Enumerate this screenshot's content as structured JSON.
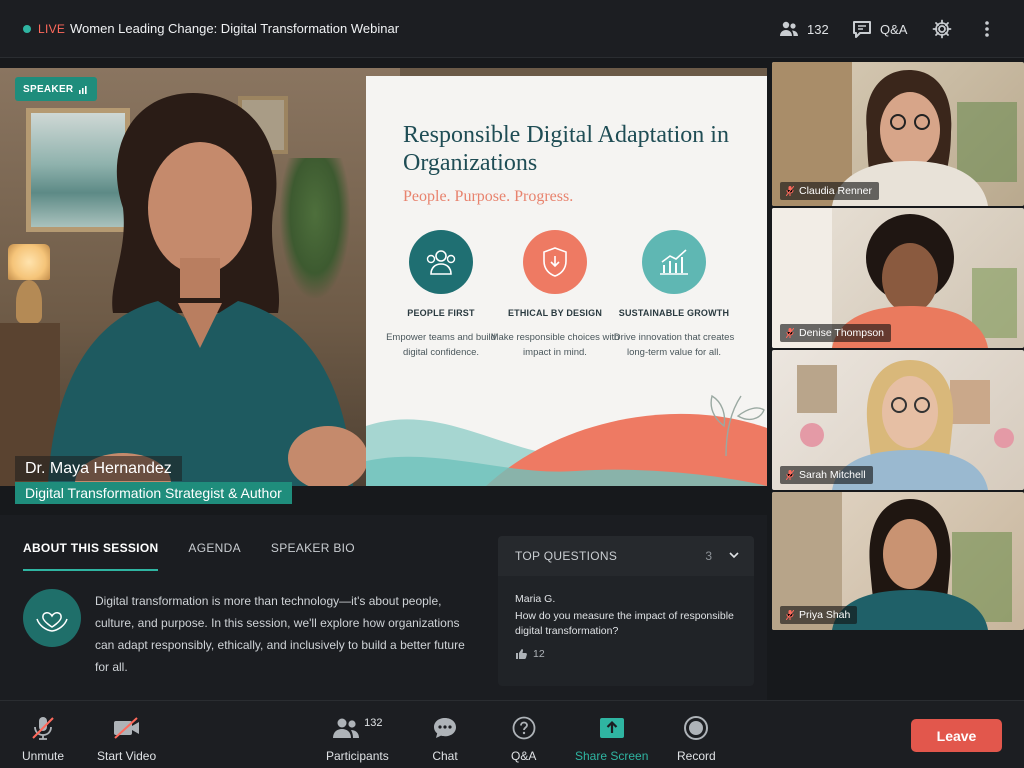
{
  "header": {
    "live_label": "LIVE",
    "title": "Women Leading Change: Digital Transformation Webinar",
    "participants_count": "132",
    "qa_label": "Q&A"
  },
  "stage": {
    "speaker_badge": "SPEAKER",
    "speaker_name": "Dr. Maya Hernandez",
    "speaker_role": "Digital Transformation Strategist & Author",
    "slide": {
      "title": "Responsible Digital Adaptation in Organizations",
      "subtitle": "People. Purpose. Progress.",
      "pillars": [
        {
          "heading": "PEOPLE FIRST",
          "text": "Empower teams and build digital confidence.",
          "color": "#1f6f72",
          "icon": "people-icon"
        },
        {
          "heading": "ETHICAL BY DESIGN",
          "text": "Make responsible choices with impact in mind.",
          "color": "#ee7a63",
          "icon": "shield-icon"
        },
        {
          "heading": "SUSTAINABLE GROWTH",
          "text": "Drive innovation that creates long-term value for all.",
          "color": "#5fb7b3",
          "icon": "growth-chart-icon"
        }
      ]
    }
  },
  "participants": [
    {
      "name": "Claudia Renner"
    },
    {
      "name": "Denise Thompson"
    },
    {
      "name": "Sarah Mitchell"
    },
    {
      "name": "Priya Shah"
    }
  ],
  "session": {
    "tabs": [
      "ABOUT THIS SESSION",
      "AGENDA",
      "SPEAKER BIO"
    ],
    "active_tab": "ABOUT THIS SESSION",
    "description": "Digital transformation is more than technology—it's about people, culture, and purpose. In this session, we'll explore how organizations can adapt responsibly, ethically, and inclusively to build a better future for all."
  },
  "questions": {
    "heading": "TOP QUESTIONS",
    "count": "3",
    "items": [
      {
        "author": "Maria G.",
        "text": "How do you measure the impact of responsible digital transformation?",
        "likes": "12"
      }
    ]
  },
  "controls": {
    "unmute": "Unmute",
    "start_video": "Start Video",
    "participants": "Participants",
    "participants_count": "132",
    "chat": "Chat",
    "qa": "Q&A",
    "share_screen": "Share Screen",
    "record": "Record",
    "leave": "Leave"
  },
  "colors": {
    "accent": "#2fb5a2",
    "live": "#ff6a5c",
    "leave": "#e2574c",
    "speaker_tag": "#1f8d7c"
  }
}
